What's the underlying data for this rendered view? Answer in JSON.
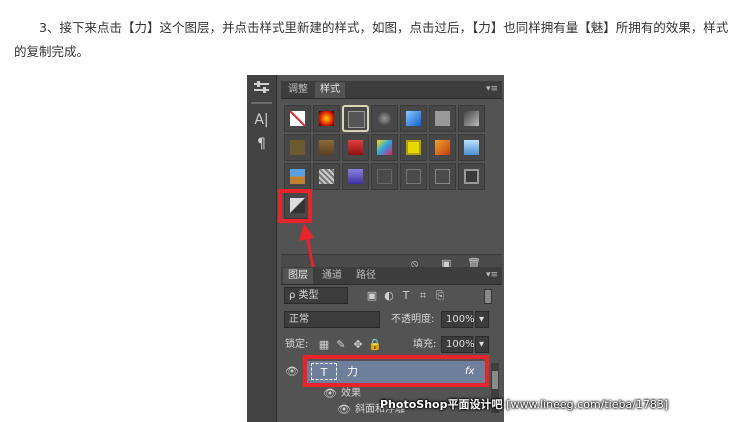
{
  "article": {
    "paragraph": "3、接下来点击【力】这个图层，并点击样式里新建的样式，如图，点击过后，【力】也同样拥有量【魅】所拥有的效果，样式的复制完成。"
  },
  "tool_strip": {
    "icons": [
      "sliders-icon",
      "character-icon",
      "paragraph-icon"
    ],
    "character_glyph": "A|",
    "paragraph_glyph": "¶"
  },
  "styles_panel": {
    "tabs": [
      {
        "label": "调整",
        "active": false
      },
      {
        "label": "样式",
        "active": true
      }
    ],
    "menu_glyph": "▾≡",
    "highlight_color": "#e8232a",
    "bottom_icons": [
      "clear-style-icon",
      "new-style-icon",
      "trash-icon"
    ]
  },
  "layers_panel": {
    "tabs": [
      {
        "label": "图层",
        "active": true
      },
      {
        "label": "通道",
        "active": false
      },
      {
        "label": "路径",
        "active": false
      }
    ],
    "filter_label": "ρ 类型",
    "blend_mode": "正常",
    "opacity_label": "不透明度:",
    "opacity_value": "100%",
    "lock_label": "锁定:",
    "fill_label": "填充:",
    "fill_value": "100%",
    "layer": {
      "type_glyph": "T",
      "name": "力",
      "fx": "fx"
    },
    "effects_label": "效果",
    "effect_item": "斜面和浮雕"
  },
  "watermark": {
    "brand": "PhotoShop平面设计吧",
    "url": "[www.lineeg.com/tieba/1783]"
  }
}
